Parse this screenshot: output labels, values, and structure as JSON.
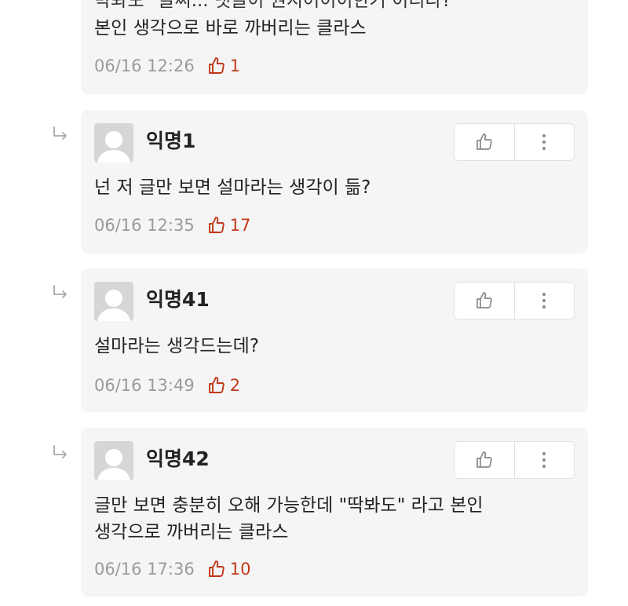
{
  "colors": {
    "card_bg": "#f5f5f5",
    "like_accent": "#c0391b",
    "meta_gray": "#9a9a9a",
    "text": "#222222"
  },
  "icons": {
    "reply": "reply-arrow-icon",
    "avatar": "default-avatar-icon",
    "like": "thumbs-up-icon",
    "more": "more-vertical-icon"
  },
  "comments": [
    {
      "partial_line": "박봐도 \"글씨... 댓글이 권지어이이한거 이리다?",
      "text_lines": [
        "본인 생각으로 바로 까버리는 클라스"
      ],
      "date": "06/16 12:26",
      "likes": "1"
    },
    {
      "username": "익명1",
      "text_lines": [
        "넌 저 글만 보면 설마라는 생각이 듦?"
      ],
      "date": "06/16 12:35",
      "likes": "17"
    },
    {
      "username": "익명41",
      "text_lines": [
        "설마라는 생각드는데?"
      ],
      "date": "06/16 13:49",
      "likes": "2"
    },
    {
      "username": "익명42",
      "text_lines": [
        "글만 보면 충분히 오해 가능한데 \"딱봐도\" 라고 본인",
        "생각으로 까버리는 클라스"
      ],
      "date": "06/16 17:36",
      "likes": "10"
    }
  ]
}
